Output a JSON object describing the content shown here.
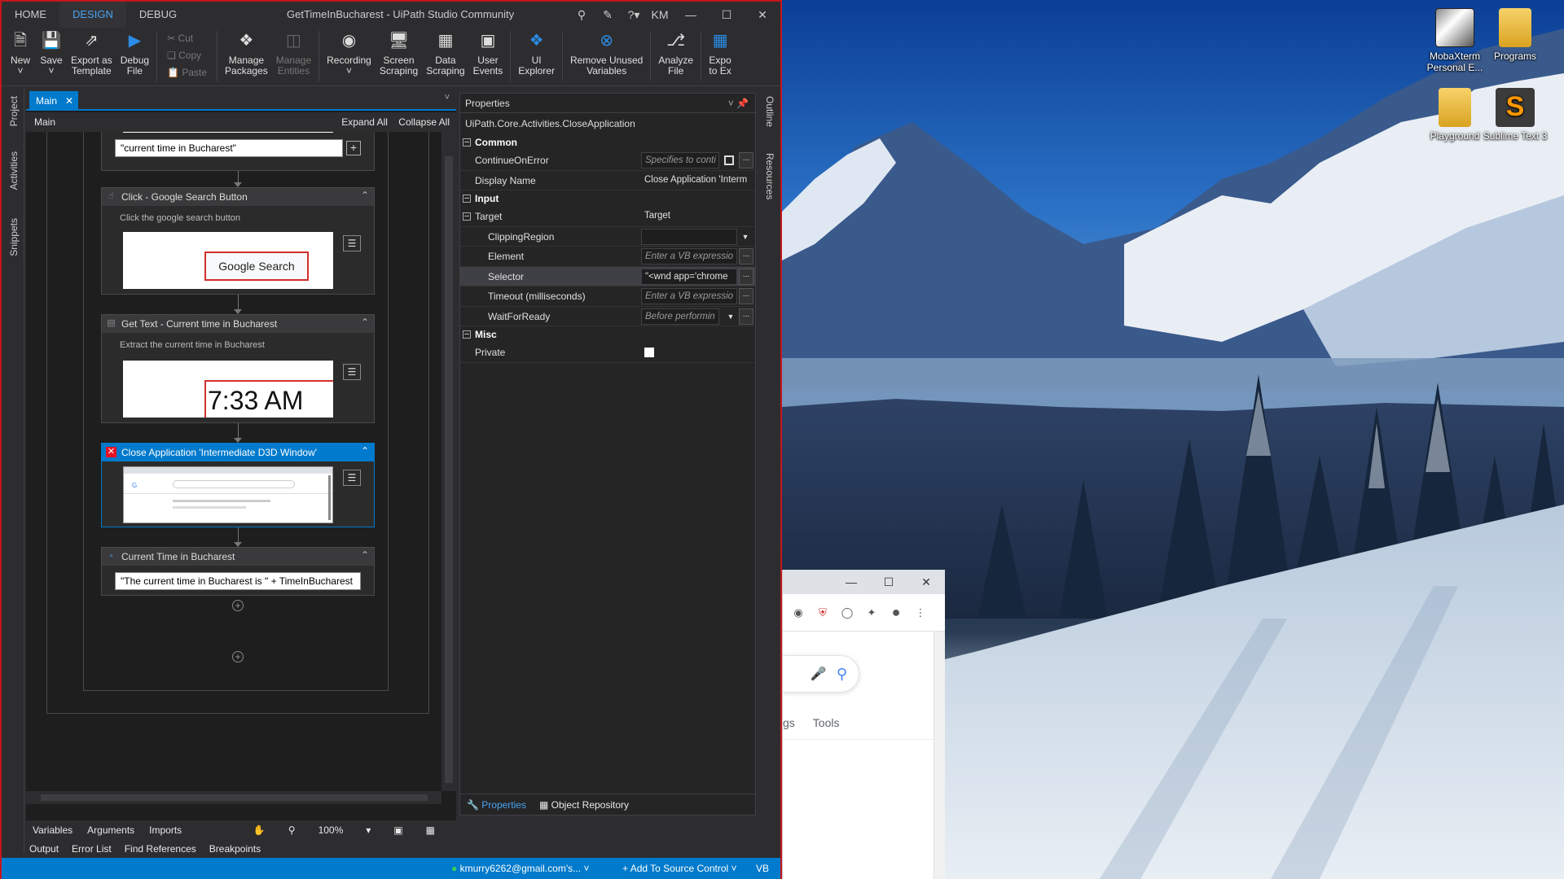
{
  "titlebar": {
    "tabs": [
      "HOME",
      "DESIGN",
      "DEBUG"
    ],
    "active_tab": "DESIGN",
    "window_title": "GetTimeInBucharest - UiPath Studio Community",
    "user_initials": "KM"
  },
  "ribbon": {
    "new": "New",
    "save": "Save",
    "export_template": [
      "Export as",
      "Template"
    ],
    "debug_file": [
      "Debug",
      "File"
    ],
    "cut": "Cut",
    "copy": "Copy",
    "paste": "Paste",
    "manage_packages": [
      "Manage",
      "Packages"
    ],
    "manage_entities": [
      "Manage",
      "Entities"
    ],
    "recording": "Recording",
    "screen_scraping": [
      "Screen",
      "Scraping"
    ],
    "data_scraping": [
      "Data",
      "Scraping"
    ],
    "user_events": [
      "User",
      "Events"
    ],
    "ui_explorer": [
      "UI",
      "Explorer"
    ],
    "remove_unused": [
      "Remove Unused",
      "Variables"
    ],
    "analyze_file": [
      "Analyze",
      "File"
    ],
    "export_excel": [
      "Expo",
      "to Ex"
    ]
  },
  "left_panel_labels": [
    "Project",
    "Activities",
    "Snippets"
  ],
  "right_panel_labels": [
    "Outline",
    "Resources"
  ],
  "designer": {
    "tab_label": "Main",
    "breadcrumb": "Main",
    "expand_all": "Expand All",
    "collapse_all": "Collapse All",
    "top_expression": "\"current time in Bucharest\"",
    "activities": [
      {
        "title": "Click - Google Search Button",
        "description": "Click the google search button",
        "screenshot_text": "Google Search"
      },
      {
        "title": "Get Text - Current time in Bucharest",
        "description": "Extract the current time in Bucharest",
        "screenshot_text": "7:33 AM"
      },
      {
        "title": "Close Application 'Intermediate D3D Window'",
        "selected": true
      },
      {
        "title": "Current Time in Bucharest",
        "expression": "\"The current time in Bucharest is \" + TimeInBucharest"
      }
    ],
    "bottom_tabs": [
      "Variables",
      "Arguments",
      "Imports"
    ],
    "zoom": "100%"
  },
  "properties": {
    "header": "Properties",
    "class_name": "UiPath.Core.Activities.CloseApplication",
    "groups": [
      {
        "name": "Common",
        "rows": [
          {
            "key": "ContinueOnError",
            "value": "Specifies to conti",
            "placeholder": true
          },
          {
            "key": "Display Name",
            "value": "Close Application 'Interm",
            "placeholder": false
          }
        ]
      },
      {
        "name": "Input",
        "rows": []
      },
      {
        "name": "Target",
        "value": "Target",
        "rows": [
          {
            "key": "ClippingRegion",
            "value": ""
          },
          {
            "key": "Element",
            "value": "Enter a VB expressio",
            "placeholder": true
          },
          {
            "key": "Selector",
            "value": "\"<wnd app='chrome",
            "placeholder": false
          },
          {
            "key": "Timeout (milliseconds)",
            "value": "Enter a VB expressio",
            "placeholder": true
          },
          {
            "key": "WaitForReady",
            "value": "Before performin",
            "placeholder": true
          }
        ]
      },
      {
        "name": "Misc",
        "rows": [
          {
            "key": "Private",
            "value": ""
          }
        ]
      }
    ],
    "footer_tabs": [
      "Properties",
      "Object Repository"
    ]
  },
  "output_tabs": [
    "Output",
    "Error List",
    "Find References",
    "Breakpoints"
  ],
  "statusbar": {
    "account": "kmurry6262@gmail.com's...",
    "source_control": "Add To Source Control",
    "language": "VB"
  },
  "desktop": {
    "icons": [
      {
        "label": "MobaXterm Personal E..."
      },
      {
        "label": "Programs"
      },
      {
        "label": "Playground"
      },
      {
        "label": "Sublime Text 3"
      }
    ],
    "browser_link": "Tools",
    "browser_link_partial": "gs"
  },
  "colors": {
    "accent": "#007acc",
    "frame": "#c4161c",
    "ui_dark": "#2d2d30"
  }
}
